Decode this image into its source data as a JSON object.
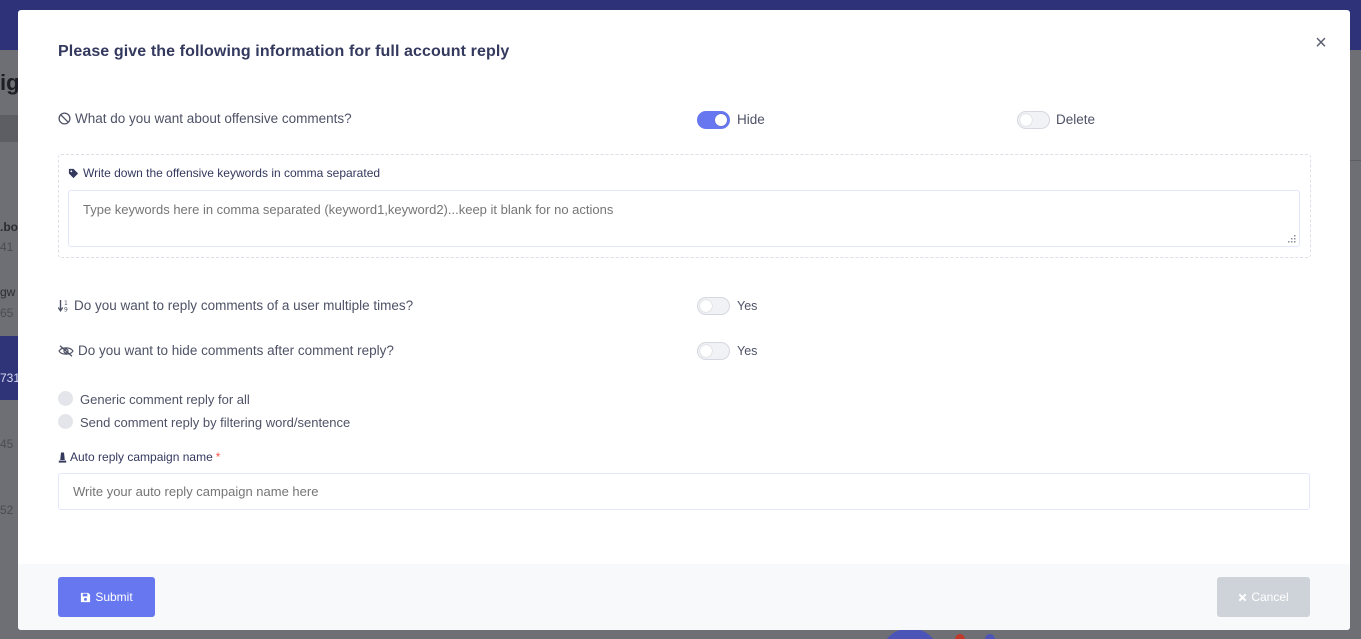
{
  "background": {
    "fragments": [
      "ig",
      ".bo",
      "41",
      "gw",
      "65",
      "731",
      "45",
      "52"
    ]
  },
  "modal": {
    "title": "Please give the following information for full account reply",
    "close_symbol": "×",
    "offensive": {
      "question": "What do you want about offensive comments?",
      "hide_label": "Hide",
      "hide_on": true,
      "delete_label": "Delete",
      "delete_on": false
    },
    "keywords": {
      "label": "Write down the offensive keywords in comma separated",
      "placeholder": "Type keywords here in comma separated (keyword1,keyword2)...keep it blank for no actions"
    },
    "multiple_reply": {
      "question": "Do you want to reply comments of a user multiple times?",
      "toggle_label": "Yes",
      "on": false
    },
    "hide_after_reply": {
      "question": "Do you want to hide comments after comment reply?",
      "toggle_label": "Yes",
      "on": false
    },
    "reply_type": {
      "options": [
        "Generic comment reply for all",
        "Send comment reply by filtering word/sentence"
      ]
    },
    "campaign": {
      "label": "Auto reply campaign name",
      "required_mark": "*",
      "placeholder": "Write your auto reply campaign name here"
    },
    "footer": {
      "submit_label": "Submit",
      "cancel_label": "Cancel"
    }
  },
  "colors": {
    "primary": "#6777ef",
    "cancel": "#cdd3d8",
    "topbar": "#2e3279",
    "required": "#fc544b"
  }
}
